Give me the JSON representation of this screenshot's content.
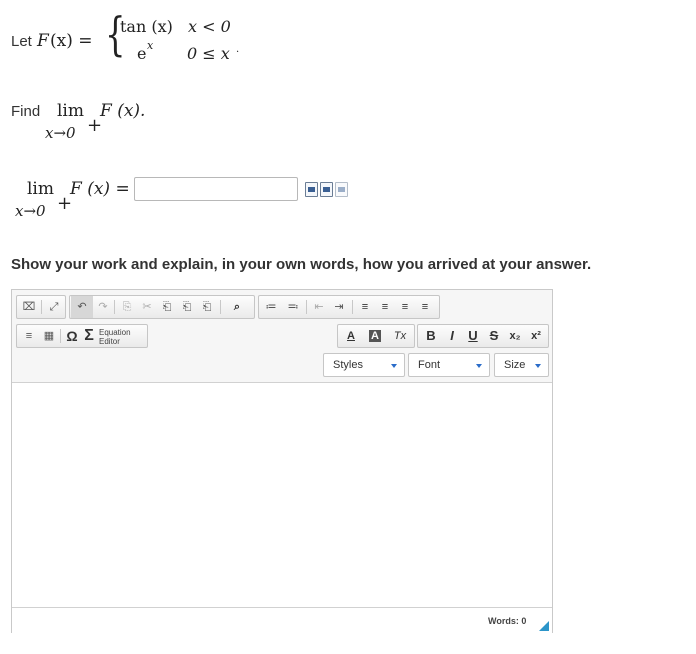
{
  "question": {
    "let_word": "Let",
    "func_name": "F",
    "func_arg": "(x) =",
    "case1_expr": "tan (x)",
    "case1_cond": "x < 0",
    "case2_expr": "e",
    "case2_exp": "x",
    "case2_cond": "0 ≤ x",
    "trailing_period": ".",
    "find_word": "Find",
    "lim_word": "lim",
    "lim_sub": "x→0",
    "lim_sup": "+",
    "lim_func": "F (x).",
    "answer_lim_func": "F (x) ="
  },
  "answer": {
    "value": "",
    "icon_names": [
      "math-preview-icon",
      "math-edit-icon",
      "math-help-icon"
    ]
  },
  "prompt": "Show your work and explain, in your own words, how you arrived at your answer.",
  "editor": {
    "row1_group1": [
      "⌧",
      "⤢"
    ],
    "row1_group2": [
      "↶",
      "↷",
      "⎘",
      "✂",
      "⎗",
      "⎗",
      "⎗",
      "⌕"
    ],
    "row1_group3": [
      "≔",
      "≕",
      "⇤",
      "⇥",
      "≡",
      "≡",
      "≡",
      "≡"
    ],
    "row2_group1": [
      "≡",
      "▦",
      "Ω",
      "Σ"
    ],
    "equation_label_1": "Equation",
    "equation_label_2": "Editor",
    "row2_color": [
      "A",
      "A",
      "Tx"
    ],
    "row2_format": [
      "B",
      "I",
      "U",
      "S",
      "x₂",
      "x²"
    ],
    "styles_label": "Styles",
    "font_label": "Font",
    "size_label": "Size",
    "word_count": "Words: 0"
  },
  "colors": {
    "accent_blue": "#2a6cc9",
    "resize_grip": "#2c95c9"
  }
}
